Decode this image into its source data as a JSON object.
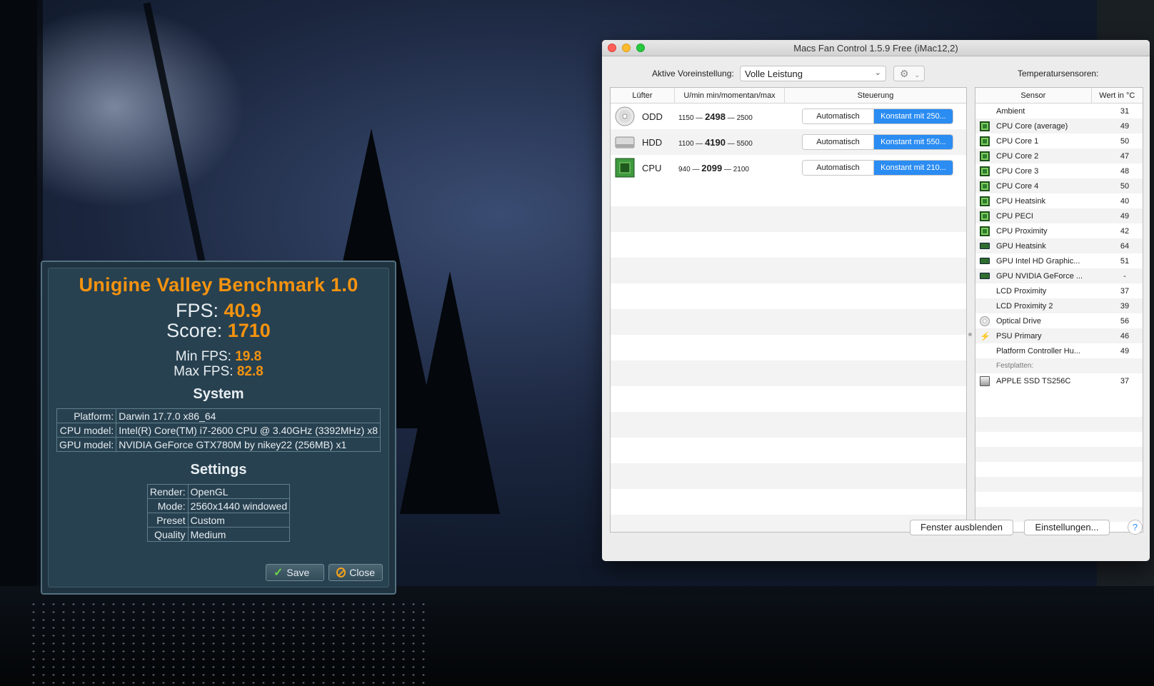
{
  "unigine": {
    "title": "Unigine Valley Benchmark 1.0",
    "fps_label": "FPS:",
    "fps": "40.9",
    "score_label": "Score:",
    "score": "1710",
    "min_fps_label": "Min FPS:",
    "min_fps": "19.8",
    "max_fps_label": "Max FPS:",
    "max_fps": "82.8",
    "system_heading": "System",
    "system": [
      {
        "key": "Platform:",
        "value": "Darwin 17.7.0 x86_64"
      },
      {
        "key": "CPU model:",
        "value": "Intel(R) Core(TM) i7-2600 CPU @ 3.40GHz (3392MHz) x8"
      },
      {
        "key": "GPU model:",
        "value": "NVIDIA GeForce GTX780M by nikey22 (256MB) x1"
      }
    ],
    "settings_heading": "Settings",
    "settings": [
      {
        "key": "Render:",
        "value": "OpenGL"
      },
      {
        "key": "Mode:",
        "value": "2560x1440 windowed"
      },
      {
        "key": "Preset",
        "value": "Custom"
      },
      {
        "key": "Quality",
        "value": "Medium"
      }
    ],
    "save_label": "Save",
    "close_label": "Close"
  },
  "macs": {
    "window_title": "Macs Fan Control 1.5.9 Free (iMac12,2)",
    "preset_label": "Aktive Voreinstellung:",
    "preset_value": "Volle Leistung",
    "temp_sensors_label": "Temperatursensoren:",
    "fans_headers": [
      "Lüfter",
      "U/min min/momentan/max",
      "Steuerung"
    ],
    "fans": [
      {
        "name": "ODD",
        "min": "1150",
        "current": "2498",
        "max": "2500",
        "auto_label": "Automatisch",
        "const_label": "Konstant mit 250..."
      },
      {
        "name": "HDD",
        "min": "1100",
        "current": "4190",
        "max": "5500",
        "auto_label": "Automatisch",
        "const_label": "Konstant mit 550..."
      },
      {
        "name": "CPU",
        "min": "940",
        "current": "2099",
        "max": "2100",
        "auto_label": "Automatisch",
        "const_label": "Konstant mit 210..."
      }
    ],
    "sensor_headers": [
      "Sensor",
      "Wert in °C"
    ],
    "sensors": [
      {
        "icon": "none",
        "name": "Ambient",
        "value": "31"
      },
      {
        "icon": "chip",
        "name": "CPU Core (average)",
        "value": "49"
      },
      {
        "icon": "chip",
        "name": "CPU Core 1",
        "value": "50"
      },
      {
        "icon": "chip",
        "name": "CPU Core 2",
        "value": "47"
      },
      {
        "icon": "chip",
        "name": "CPU Core 3",
        "value": "48"
      },
      {
        "icon": "chip",
        "name": "CPU Core 4",
        "value": "50"
      },
      {
        "icon": "chip",
        "name": "CPU Heatsink",
        "value": "40"
      },
      {
        "icon": "chip",
        "name": "CPU PECI",
        "value": "49"
      },
      {
        "icon": "chip",
        "name": "CPU Proximity",
        "value": "42"
      },
      {
        "icon": "gpu",
        "name": "GPU Heatsink",
        "value": "64"
      },
      {
        "icon": "gpu",
        "name": "GPU Intel HD Graphic...",
        "value": "51"
      },
      {
        "icon": "gpu",
        "name": "GPU NVIDIA GeForce ...",
        "value": "-"
      },
      {
        "icon": "none",
        "name": "LCD Proximity",
        "value": "37"
      },
      {
        "icon": "none",
        "name": "LCD Proximity 2",
        "value": "39"
      },
      {
        "icon": "disc",
        "name": "Optical Drive",
        "value": "56"
      },
      {
        "icon": "bolt",
        "name": "PSU Primary",
        "value": "46"
      },
      {
        "icon": "none",
        "name": "Platform Controller Hu...",
        "value": "49"
      }
    ],
    "disks_group_label": "Festplatten:",
    "disks": [
      {
        "icon": "ssd",
        "name": "APPLE SSD TS256C",
        "value": "37"
      }
    ],
    "hide_window_label": "Fenster ausblenden",
    "settings_button_label": "Einstellungen...",
    "help_label": "?"
  }
}
